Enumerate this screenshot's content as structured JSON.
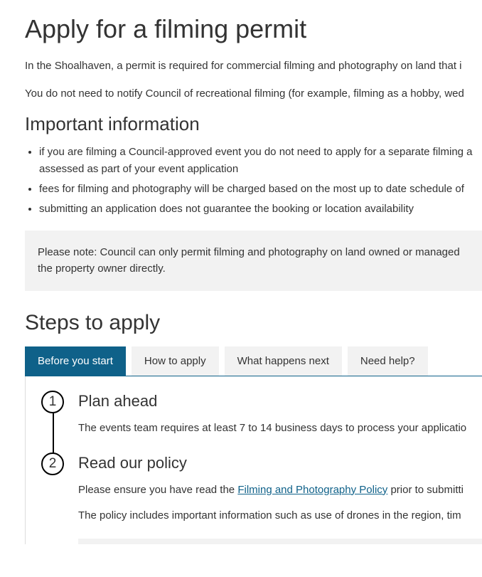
{
  "title": "Apply for a filming permit",
  "intro1": "In the Shoalhaven, a permit is required for commercial filming and photography on land that i",
  "intro2": "You do not need to notify Council of recreational filming (for example, filming as a hobby, wed",
  "important_heading": "Important information",
  "bullets": [
    "if you are filming a Council-approved event you do not need to apply for a separate filming a assessed as part of your event application",
    "fees for filming and photography will be charged based on the most up to date schedule of",
    "submitting an application does not guarantee the booking or location availability"
  ],
  "note": "Please note: Council can only permit filming and photography on land owned or managed the property owner directly.",
  "steps_heading": "Steps to apply",
  "tabs": [
    "Before you start",
    "How to apply",
    "What happens next",
    "Need help?"
  ],
  "steps": [
    {
      "num": "1",
      "title": "Plan ahead",
      "body": "The events team requires at least 7 to 14 business days to process your applicatio"
    },
    {
      "num": "2",
      "title": "Read our policy",
      "body_pre": "Please ensure you have read the ",
      "body_link": "Filming and Photography Policy",
      "body_post": " prior to submitti",
      "body2": "The policy includes important information such as use of drones in the region, tim"
    }
  ]
}
